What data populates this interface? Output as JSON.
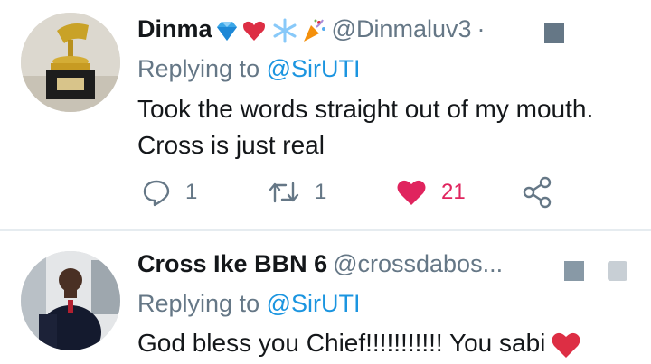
{
  "tweets": [
    {
      "name": "Dinma",
      "handle": "@Dinmaluv3",
      "separator": "·",
      "replying_prefix": "Replying to",
      "replying_to": "@SirUTI",
      "text": "Took the words straight out of my mouth. Cross is just real",
      "emojis": [
        "gem-icon",
        "red-heart-icon",
        "snowflake-icon",
        "party-popper-icon"
      ],
      "actions": {
        "replies": "1",
        "retweets": "1",
        "likes": "21"
      }
    },
    {
      "name": "Cross Ike BBN 6",
      "handle": "@crossdabos...",
      "replying_prefix": "Replying to",
      "replying_to": "@SirUTI",
      "text": "God bless you Chief!!!!!!!!!!! You sabi"
    }
  ],
  "colors": {
    "link": "#1b95e0",
    "like": "#e0245e",
    "muted": "#657786"
  }
}
